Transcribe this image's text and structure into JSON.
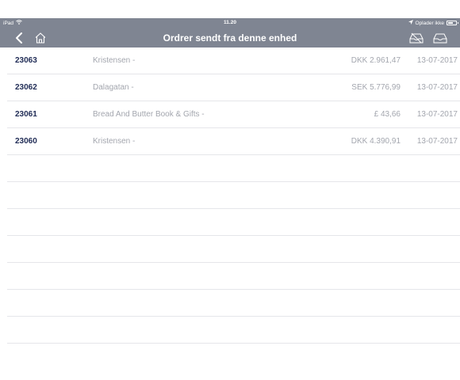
{
  "status_bar": {
    "device": "iPad",
    "time": "11.20",
    "charging_text": "Oplader ikke"
  },
  "nav": {
    "title": "Ordrer sendt fra denne enhed"
  },
  "orders": [
    {
      "number": "23063",
      "customer": "Kristensen -",
      "amount": "DKK 2.961,47",
      "date": "13-07-2017"
    },
    {
      "number": "23062",
      "customer": "Dalagatan -",
      "amount": "SEK 5.776,99",
      "date": "13-07-2017"
    },
    {
      "number": "23061",
      "customer": "Bread And Butter Book & Gifts -",
      "amount": "£ 43,66",
      "date": "13-07-2017"
    },
    {
      "number": "23060",
      "customer": "Kristensen -",
      "amount": "DKK 4.390,91",
      "date": "13-07-2017"
    }
  ],
  "colors": {
    "bar": "#7f8592",
    "order_number": "#1f2b55",
    "secondary_text": "#a3a6ae",
    "divider": "#e5e6ea"
  },
  "icons": {
    "back": "chevron-left-icon",
    "home": "home-icon",
    "inbox_alt": "inbox-crossed-icon",
    "inbox": "inbox-icon",
    "wifi": "wifi-icon",
    "location": "location-arrow-icon",
    "battery": "battery-icon"
  }
}
